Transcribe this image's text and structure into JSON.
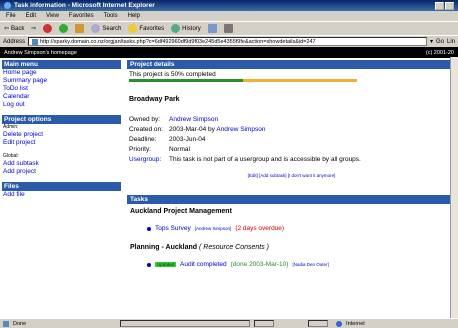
{
  "window": {
    "title": "Task information - Microsoft Internet Explorer"
  },
  "menu": [
    "File",
    "Edit",
    "View",
    "Favorites",
    "Tools",
    "Help"
  ],
  "toolbar": {
    "back": "Back",
    "search": "Search",
    "favorites": "Favorites",
    "history": "History"
  },
  "address": {
    "label": "Address",
    "url": "http://sparky.domain.co.nz/orgjan/tasks.php?c=6df492960df9d9f03e245d5e4355f9fe&action=showdetails&id=247",
    "go": "Go",
    "links": "Lin"
  },
  "homebar": {
    "left": "Andrew Simpson's homepage",
    "right": "(c) 2001-20"
  },
  "sidebar": {
    "main_menu": {
      "title": "Main menu",
      "items": [
        "Home page",
        "Summary page",
        "ToDo list",
        "Calendar",
        "Log out"
      ]
    },
    "project_options": {
      "title": "Project options",
      "admin_label": "Admin:",
      "admin_items": [
        "Delete project",
        "Edit project"
      ],
      "global_label": "Global:",
      "global_items": [
        "Add subtask",
        "Add project"
      ]
    },
    "files": {
      "title": "Files",
      "items": [
        "Add file"
      ]
    }
  },
  "project": {
    "header": "Project details",
    "progress_text": "This project is 50% completed",
    "progress": 0.5,
    "name": "Broadway Park",
    "owned_by_label": "Owned by:",
    "owned_by": "Andrew Simpson",
    "created_label": "Created on:",
    "created": "2003-Mar-04",
    "created_by_word": "by",
    "created_by": "Andrew Simpson",
    "deadline_label": "Deadline:",
    "deadline": "2003-Jun-04",
    "priority_label": "Priority:",
    "priority": "Normal",
    "usergroup_label": "Usergroup:",
    "usergroup_text": "This task is not part of a usergroup and is accessible by all groups.",
    "actions": "[Edit] [Add subtask] [I don't want it anymore]"
  },
  "tasks": {
    "header": "Tasks",
    "groups": [
      {
        "title": "Auckland Project Management",
        "subtitle": "",
        "task": {
          "name": "Tops Survey",
          "person": "[Andrew Simpson]",
          "status": "(2 days overdue)",
          "badge": ""
        }
      },
      {
        "title": "Planning - Auckland",
        "subtitle": "( Resource Consents )",
        "task": {
          "name": "Audit completed",
          "person": "[Nadia Den Outer]",
          "status": "(done 2003-Mar-10)",
          "badge": "Updated"
        }
      }
    ]
  },
  "status": {
    "text": "Done",
    "zone": "Internet"
  },
  "colors": {
    "header_blue": "#2a5aa8",
    "link": "#0000cc",
    "progress_done": "#2e8b2e",
    "progress_left": "#f0b030"
  }
}
